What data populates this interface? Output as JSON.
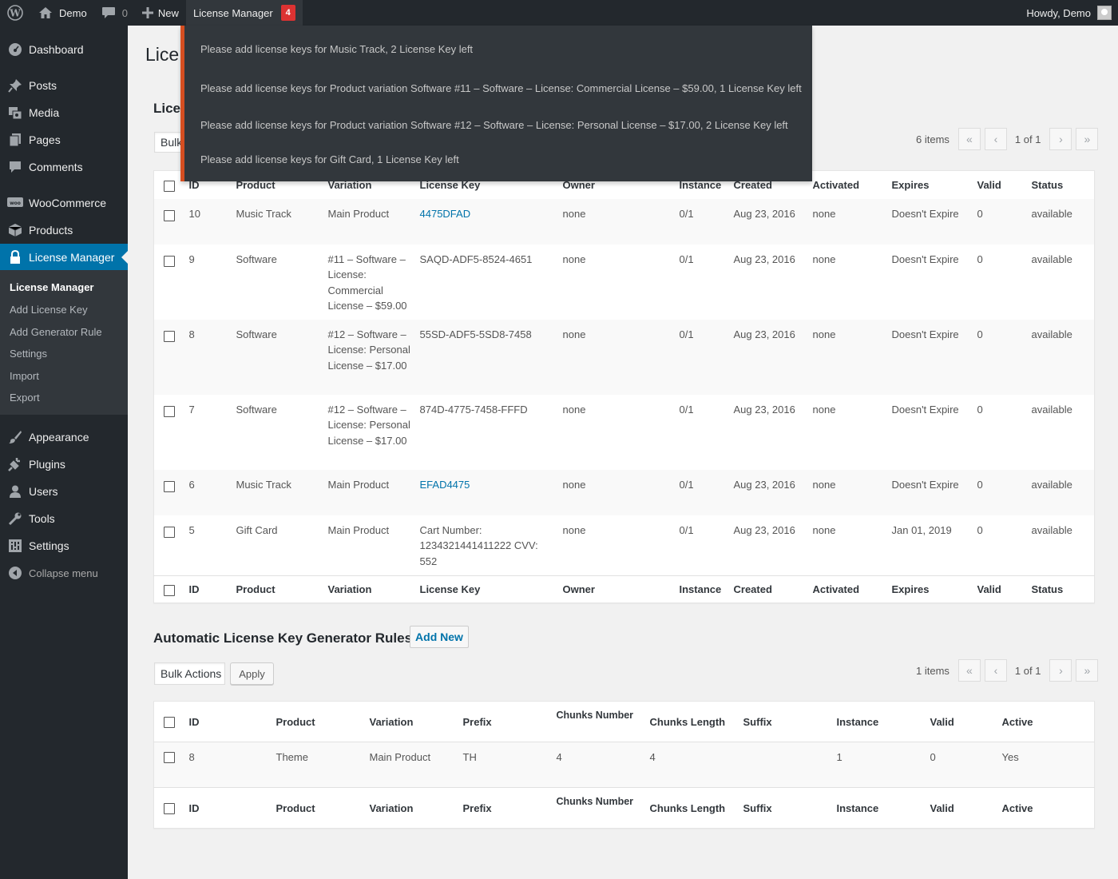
{
  "adminbar": {
    "site_name": "Demo",
    "comments_count": "0",
    "new_label": "New",
    "license_manager_label": "License Manager",
    "notice_count": "4",
    "greeting": "Howdy, Demo"
  },
  "notices": [
    "Please add license keys for Music Track, 2 License Key left",
    "Please add license keys for Product variation Software #11 – Software – License: Commercial License – $59.00, 1 License Key left",
    "Please add license keys for Product variation Software #12 – Software – License: Personal License – $17.00, 2 License Key left",
    "Please add license keys for Gift Card, 1 License Key left"
  ],
  "sidebar": {
    "items": [
      {
        "label": "Dashboard",
        "icon": "dashboard-icon"
      },
      {
        "label": "Posts",
        "icon": "pin-icon"
      },
      {
        "label": "Media",
        "icon": "media-icon"
      },
      {
        "label": "Pages",
        "icon": "pages-icon"
      },
      {
        "label": "Comments",
        "icon": "comment-icon"
      },
      {
        "label": "WooCommerce",
        "icon": "woo-icon"
      },
      {
        "label": "Products",
        "icon": "box-icon"
      },
      {
        "label": "License Manager",
        "icon": "lock-icon"
      },
      {
        "label": "Appearance",
        "icon": "brush-icon"
      },
      {
        "label": "Plugins",
        "icon": "plug-icon"
      },
      {
        "label": "Users",
        "icon": "user-icon"
      },
      {
        "label": "Tools",
        "icon": "wrench-icon"
      },
      {
        "label": "Settings",
        "icon": "settings-icon"
      }
    ],
    "submenu": [
      "License Manager",
      "Add License Key",
      "Add Generator Rule",
      "Settings",
      "Import",
      "Export"
    ],
    "collapse_label": "Collapse menu"
  },
  "page": {
    "title": "Lice",
    "section1_title": "Lice",
    "bulk_partial": "Bulk",
    "items_count": "6 items",
    "page_of": "1 of 1"
  },
  "license_table": {
    "headers": [
      "ID",
      "Product",
      "Variation",
      "License Key",
      "Owner",
      "Instance",
      "Created",
      "Activated",
      "Expires",
      "Valid",
      "Status"
    ],
    "rows": [
      {
        "id": "10",
        "product": "Music Track",
        "variation": "Main Product",
        "key": "4475DFAD",
        "key_link": true,
        "owner": "none",
        "instance": "0/1",
        "created": "Aug 23, 2016",
        "activated": "none",
        "expires": "Doesn't Expire",
        "valid": "0",
        "status": "available"
      },
      {
        "id": "9",
        "product": "Software",
        "variation": "#11 – Software – License: Commercial License – $59.00",
        "key": "SAQD-ADF5-8524-4651",
        "key_link": false,
        "owner": "none",
        "instance": "0/1",
        "created": "Aug 23, 2016",
        "activated": "none",
        "expires": "Doesn't Expire",
        "valid": "0",
        "status": "available"
      },
      {
        "id": "8",
        "product": "Software",
        "variation": "#12 – Software – License: Personal License – $17.00",
        "key": "55SD-ADF5-5SD8-7458",
        "key_link": false,
        "owner": "none",
        "instance": "0/1",
        "created": "Aug 23, 2016",
        "activated": "none",
        "expires": "Doesn't Expire",
        "valid": "0",
        "status": "available"
      },
      {
        "id": "7",
        "product": "Software",
        "variation": "#12 – Software – License: Personal License – $17.00",
        "key": "874D-4775-7458-FFFD",
        "key_link": false,
        "owner": "none",
        "instance": "0/1",
        "created": "Aug 23, 2016",
        "activated": "none",
        "expires": "Doesn't Expire",
        "valid": "0",
        "status": "available"
      },
      {
        "id": "6",
        "product": "Music Track",
        "variation": "Main Product",
        "key": "EFAD4475",
        "key_link": true,
        "owner": "none",
        "instance": "0/1",
        "created": "Aug 23, 2016",
        "activated": "none",
        "expires": "Doesn't Expire",
        "valid": "0",
        "status": "available"
      },
      {
        "id": "5",
        "product": "Gift Card",
        "variation": "Main Product",
        "key": "Cart Number: 1234321441411222 CVV: 552",
        "key_link": false,
        "owner": "none",
        "instance": "0/1",
        "created": "Aug 23, 2016",
        "activated": "none",
        "expires": "Jan 01, 2019",
        "valid": "0",
        "status": "available"
      }
    ]
  },
  "generator": {
    "title": "Automatic License Key Generator Rules",
    "add_new": "Add New",
    "bulk_actions": "Bulk Actions",
    "apply": "Apply",
    "items_count": "1 items",
    "page_of": "1 of 1",
    "headers": [
      "ID",
      "Product",
      "Variation",
      "Prefix",
      "Chunks Number",
      "Chunks Length",
      "Suffix",
      "Instance",
      "Valid",
      "Active"
    ],
    "rows": [
      {
        "id": "8",
        "product": "Theme",
        "variation": "Main Product",
        "prefix": "TH",
        "chunks_number": "4",
        "chunks_length": "4",
        "suffix": "",
        "instance": "1",
        "valid": "0",
        "active": "Yes"
      }
    ]
  },
  "colors": {
    "adminbar": "#23282d",
    "accent": "#0073aa",
    "notice_border": "#d54e21",
    "badge": "#dc3232"
  }
}
